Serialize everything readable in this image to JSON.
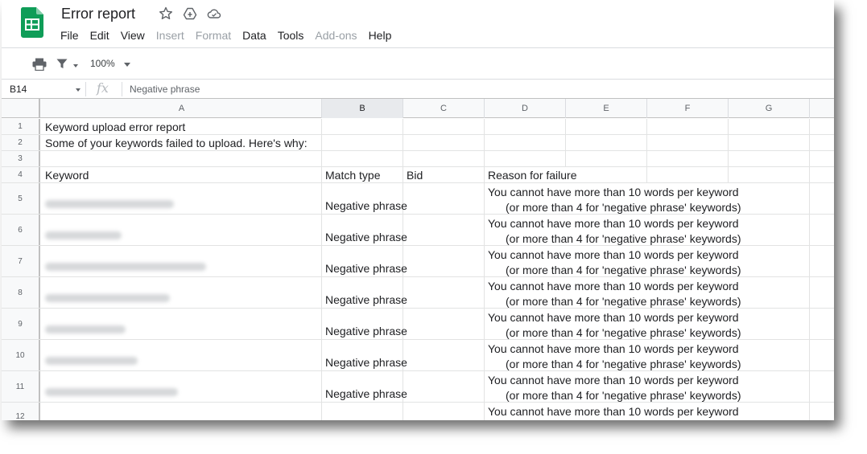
{
  "app": {
    "title": "Error report",
    "menu": [
      {
        "label": "File",
        "disabled": false
      },
      {
        "label": "Edit",
        "disabled": false
      },
      {
        "label": "View",
        "disabled": false
      },
      {
        "label": "Insert",
        "disabled": true
      },
      {
        "label": "Format",
        "disabled": true
      },
      {
        "label": "Data",
        "disabled": false
      },
      {
        "label": "Tools",
        "disabled": false
      },
      {
        "label": "Add-ons",
        "disabled": true
      },
      {
        "label": "Help",
        "disabled": false
      }
    ],
    "title_icons": [
      "star-icon",
      "move-to-drive-icon",
      "cloud-status-icon"
    ]
  },
  "toolbar": {
    "zoom": "100%",
    "icons": [
      "print-icon",
      "filter-icon",
      "zoom-dropdown-icon"
    ]
  },
  "formula_bar": {
    "cell_ref": "B14",
    "fx": "fx",
    "content": "Negative phrase"
  },
  "grid": {
    "columns": [
      "A",
      "B",
      "C",
      "D",
      "E",
      "F",
      "G"
    ],
    "selected_column": "B",
    "row_numbers": [
      "1",
      "2",
      "3",
      "4",
      "5",
      "6",
      "7",
      "8",
      "9",
      "10",
      "11",
      "12"
    ],
    "rows": {
      "r1": {
        "a": "Keyword upload error report"
      },
      "r2": {
        "a": "Some of your keywords failed to upload. Here's why:"
      },
      "r4": {
        "a": "Keyword",
        "b": "Match type",
        "c": "Bid",
        "d": "Reason for failure"
      },
      "data": [
        {
          "match_type": "Negative phrase",
          "reason_line1": "You cannot have more than 10 words per keyword",
          "reason_line2": "(or more than 4 for 'negative phrase' keywords)"
        },
        {
          "match_type": "Negative phrase",
          "reason_line1": "You cannot have more than 10 words per keyword",
          "reason_line2": "(or more than 4 for 'negative phrase' keywords)"
        },
        {
          "match_type": "Negative phrase",
          "reason_line1": "You cannot have more than 10 words per keyword",
          "reason_line2": "(or more than 4 for 'negative phrase' keywords)"
        },
        {
          "match_type": "Negative phrase",
          "reason_line1": "You cannot have more than 10 words per keyword",
          "reason_line2": "(or more than 4 for 'negative phrase' keywords)"
        },
        {
          "match_type": "Negative phrase",
          "reason_line1": "You cannot have more than 10 words per keyword",
          "reason_line2": "(or more than 4 for 'negative phrase' keywords)"
        },
        {
          "match_type": "Negative phrase",
          "reason_line1": "You cannot have more than 10 words per keyword",
          "reason_line2": "(or more than 4 for 'negative phrase' keywords)"
        },
        {
          "match_type": "Negative phrase",
          "reason_line1": "You cannot have more than 10 words per keyword",
          "reason_line2": "(or more than 4 for 'negative phrase' keywords)"
        }
      ],
      "r12": {
        "reason_line1": "You cannot have more than 10 words per keyword"
      }
    }
  },
  "colors": {
    "sheets_green": "#0f9d58",
    "header_bg": "#f8f9fa",
    "selected_header_bg": "#e8eaed",
    "disabled_menu": "#9aa0a6"
  }
}
